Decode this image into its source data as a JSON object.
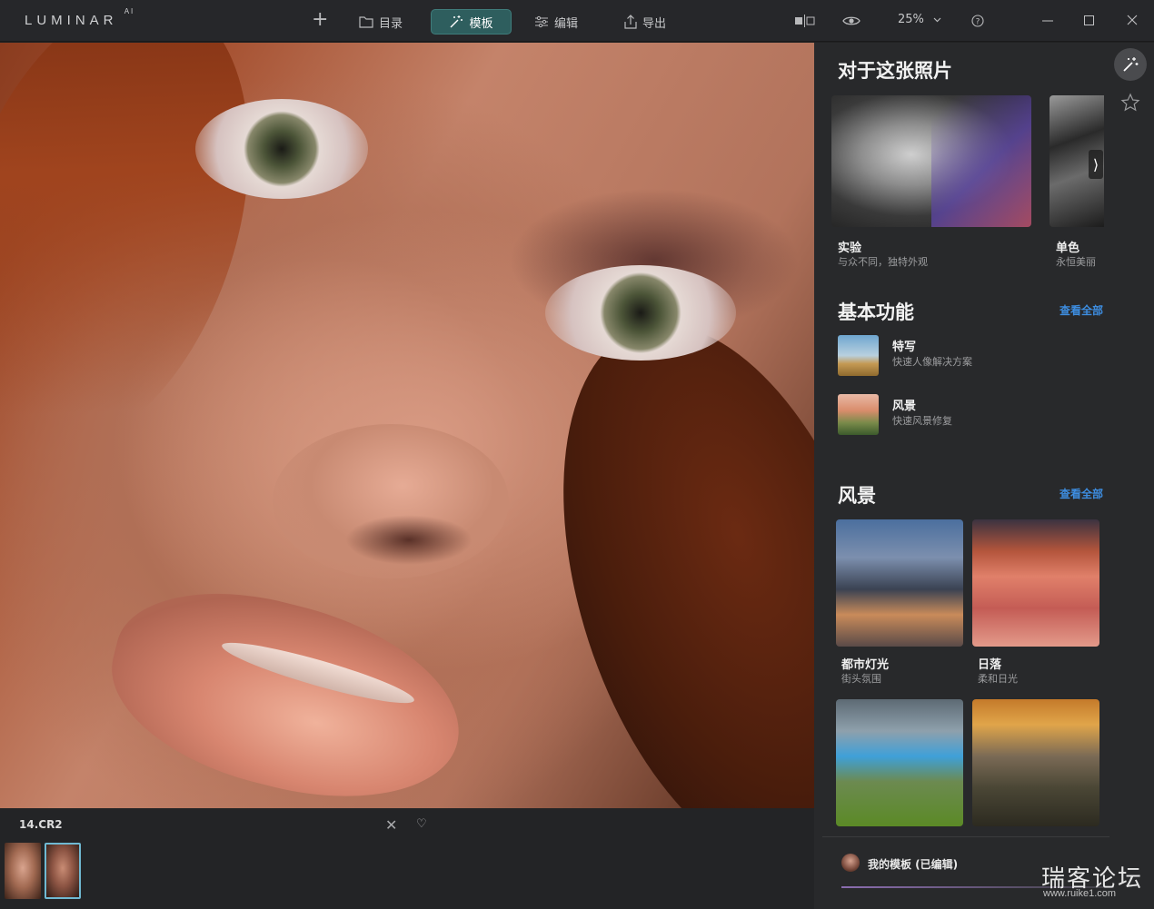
{
  "app": {
    "logo": "LUMINAR",
    "logo_suffix": "AI"
  },
  "toolbar": {
    "catalog": "目录",
    "templates": "模板",
    "edit": "编辑",
    "export": "导出",
    "zoom": "25%",
    "active_color": "#2e5e5e"
  },
  "photo": {
    "filename": "14.CR2"
  },
  "panel": {
    "for_this_photo": {
      "title": "对于这张照片",
      "cards": [
        {
          "title": "实验",
          "subtitle": "与众不同，独特外观"
        },
        {
          "title": "单色",
          "subtitle": "永恒美丽"
        }
      ]
    },
    "basics": {
      "title": "基本功能",
      "view_all": "查看全部",
      "items": [
        {
          "title": "特写",
          "subtitle": "快速人像解决方案"
        },
        {
          "title": "风景",
          "subtitle": "快速风景修复"
        }
      ]
    },
    "landscape": {
      "title": "风景",
      "view_all": "查看全部",
      "cards": [
        {
          "title": "都市灯光",
          "subtitle": "街头氛围"
        },
        {
          "title": "日落",
          "subtitle": "柔和日光"
        }
      ]
    },
    "my_templates": "我的模板 (已编辑)"
  },
  "watermark": {
    "text": "瑞客论坛",
    "url": "www.ruike1.com"
  }
}
